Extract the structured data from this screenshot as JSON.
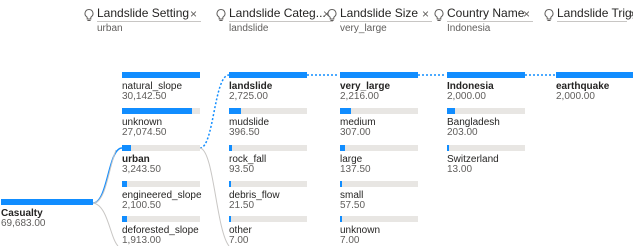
{
  "filters": [
    {
      "title": "Landslide Setting",
      "value": "urban"
    },
    {
      "title": "Landslide Categ...",
      "value": "landslide"
    },
    {
      "title": "Landslide Size",
      "value": "very_large"
    },
    {
      "title": "Country Name",
      "value": "Indonesia"
    },
    {
      "title": "Landslide Trigger",
      "value": ""
    }
  ],
  "close_glyph": "×",
  "root": {
    "label": "Casualty",
    "value": "69,683.00",
    "fraction": 1.0
  },
  "setting": [
    {
      "label": "natural_slope",
      "value": "30,142.50",
      "fraction": 1.0
    },
    {
      "label": "unknown",
      "value": "27,074.50",
      "fraction": 0.9
    },
    {
      "label": "urban",
      "value": "3,243.50",
      "fraction": 0.11
    },
    {
      "label": "engineered_slope",
      "value": "2,100.50",
      "fraction": 0.07
    },
    {
      "label": "deforested_slope",
      "value": "1,913.00",
      "fraction": 0.06
    }
  ],
  "category": [
    {
      "label": "landslide",
      "value": "2,725.00",
      "fraction": 1.0
    },
    {
      "label": "mudslide",
      "value": "396.50",
      "fraction": 0.15
    },
    {
      "label": "rock_fall",
      "value": "93.50",
      "fraction": 0.035
    },
    {
      "label": "debris_flow",
      "value": "21.50",
      "fraction": 0.01
    },
    {
      "label": "other",
      "value": "7.00",
      "fraction": 0.004
    }
  ],
  "size": [
    {
      "label": "very_large",
      "value": "2,216.00",
      "fraction": 1.0
    },
    {
      "label": "medium",
      "value": "307.00",
      "fraction": 0.14
    },
    {
      "label": "large",
      "value": "137.50",
      "fraction": 0.06
    },
    {
      "label": "small",
      "value": "57.50",
      "fraction": 0.026
    },
    {
      "label": "unknown",
      "value": "7.00",
      "fraction": 0.004
    }
  ],
  "country": [
    {
      "label": "Indonesia",
      "value": "2,000.00",
      "fraction": 1.0
    },
    {
      "label": "Bangladesh",
      "value": "203.00",
      "fraction": 0.1
    },
    {
      "label": "Switzerland",
      "value": "13.00",
      "fraction": 0.007
    }
  ],
  "trigger": [
    {
      "label": "earthquake",
      "value": "2,000.00",
      "fraction": 1.0
    }
  ],
  "colors": {
    "accent": "#118dff",
    "track": "#e8e6e3",
    "connector": "#118dff"
  }
}
